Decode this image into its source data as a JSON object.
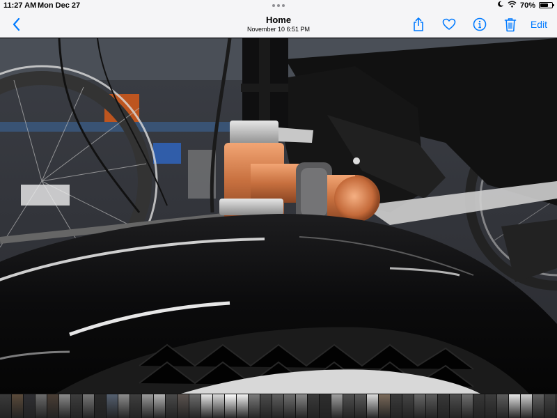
{
  "status_bar": {
    "time": "11:27 AM",
    "date": "Mon Dec 27",
    "battery_percent": "70%",
    "battery_level": 0.7,
    "icons": [
      "moon-rotation-icon",
      "wifi-icon",
      "battery-icon"
    ]
  },
  "nav": {
    "title": "Home",
    "subtitle": "November 10  6:51 PM",
    "edit_label": "Edit",
    "accent_color": "#007aff",
    "icons": [
      "back-chevron-icon",
      "share-icon",
      "heart-icon",
      "info-icon",
      "trash-icon"
    ]
  },
  "photo": {
    "description_icon": "photo-viewer"
  },
  "filmstrip": {
    "thumbnails": [
      "#3a3a3a",
      "#5a4a3a",
      "#2f2f33",
      "#6b6b6b",
      "#4a3e35",
      "#8a8a8a",
      "#3d3d3d",
      "#777777",
      "#2a2a2a",
      "#556070",
      "#8d8d8d",
      "#3e3e3e",
      "#9a9a9a",
      "#b4b4b4",
      "#4a4a4a",
      "#5c5450",
      "#6d6d6d",
      "#e8e8e8",
      "#d9d9d9",
      "#ffffff",
      "#f2f2f2",
      "#7a7a7a",
      "#4c4c4c",
      "#5f5f5f",
      "#6e6e6e",
      "#888888",
      "#3a3a3a",
      "#2e2e2e",
      "#a0a0a0",
      "#505050",
      "#5a5a5a",
      "#dcdcdc",
      "#7a6a5a",
      "#3b3b3b",
      "#444444",
      "#676767",
      "#5b5b5b",
      "#393939",
      "#4f4f4f",
      "#707070",
      "#383838",
      "#3c3c3c",
      "#5d5d5d",
      "#e6e6e6",
      "#d0d0d0",
      "#606060",
      "#424242",
      "#353535",
      "#a45a3a",
      "#b86a40",
      "#4b4b4b",
      "#6a6a6a",
      "#3f3f3f",
      "#575757",
      "#c45a3a",
      "#3a3a3a",
      "#2d2d2d",
      "#6c6c6c",
      "#474747",
      "#5e5e5e",
      "#3b3b3b",
      "#2a2a2a",
      "#505050",
      "#444444",
      "#3e3e3e",
      "#5a5a5a",
      "#363636",
      "#4a4a4a",
      "#606060",
      "#555555",
      "#3d3d3d",
      "#2b2b2b",
      "#4f4f4f",
      "#5b5b5b",
      "#343434",
      "#666666",
      "#484848",
      "#3a3a3a",
      "#525252",
      "#2f2f2f"
    ]
  }
}
